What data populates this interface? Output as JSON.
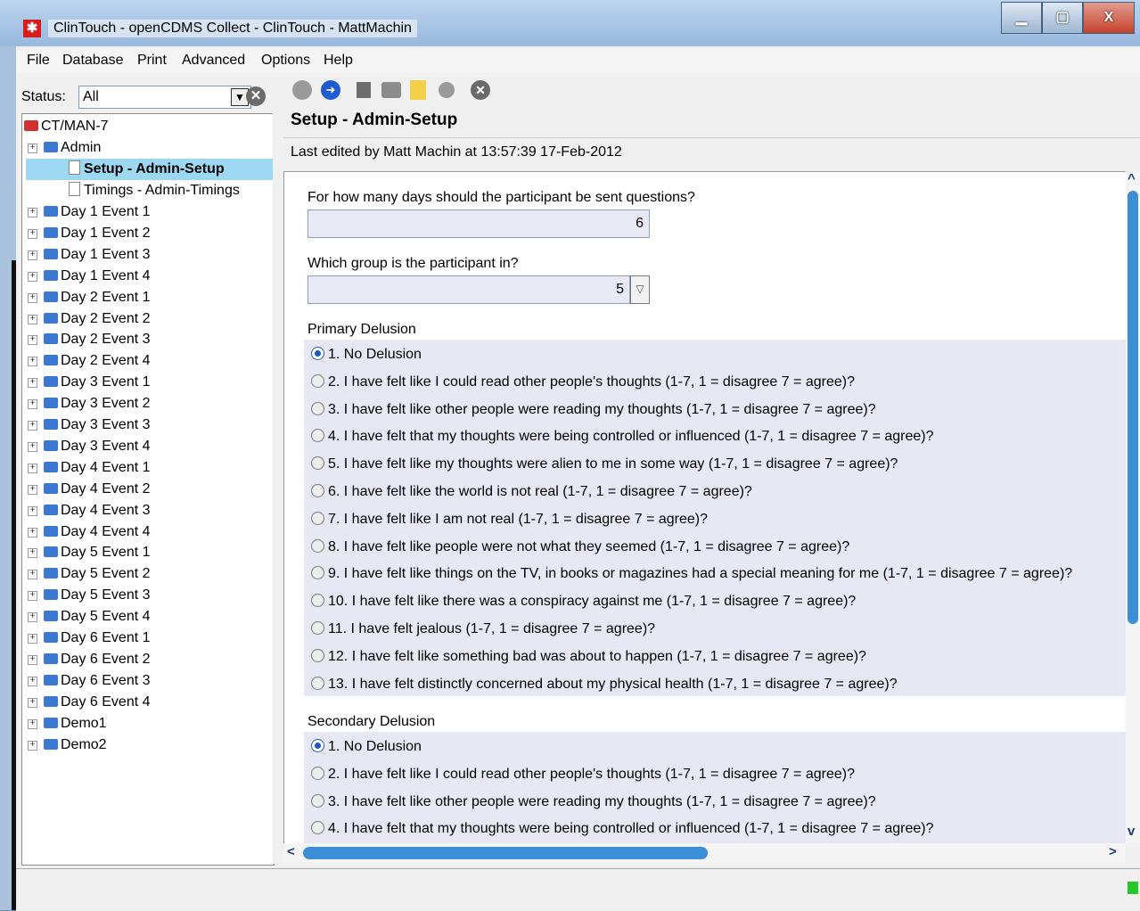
{
  "window": {
    "title": "ClinTouch - openCDMS Collect - ClinTouch - MattMachin",
    "minimize": "▁",
    "maximize": "▢",
    "close": "X"
  },
  "menu": [
    "File",
    "Database",
    "Print",
    "Advanced",
    "Options",
    "Help"
  ],
  "status": {
    "label": "Status:",
    "value": "All"
  },
  "tree": {
    "root": "CT/MAN-7",
    "admin": "Admin",
    "selected": "Setup - Admin-Setup",
    "timings": "Timings - Admin-Timings",
    "events": [
      "Day 1 Event 1",
      "Day 1 Event 2",
      "Day 1 Event 3",
      "Day 1 Event 4",
      "Day 2 Event 1",
      "Day 2 Event 2",
      "Day 2 Event 3",
      "Day 2 Event 4",
      "Day 3 Event 1",
      "Day 3 Event 2",
      "Day 3 Event 3",
      "Day 3 Event 4",
      "Day 4 Event 1",
      "Day 4 Event 2",
      "Day 4 Event 3",
      "Day 4 Event 4",
      "Day 5 Event 1",
      "Day 5 Event 2",
      "Day 5 Event 3",
      "Day 5 Event 4",
      "Day 6 Event 1",
      "Day 6 Event 2",
      "Day 6 Event 3",
      "Day 6 Event 4",
      "Demo1",
      "Demo2"
    ]
  },
  "form": {
    "title": "Setup - Admin-Setup",
    "last_edited": "Last edited by Matt Machin at 13:57:39 17-Feb-2012",
    "q1": {
      "label": "For how many days should the participant be sent questions?",
      "value": "6"
    },
    "q2": {
      "label": "Which group is the participant in?",
      "value": "5"
    },
    "primary": {
      "label": "Primary Delusion",
      "selected_index": 0,
      "options": [
        "1. No Delusion",
        "2. I have felt like I could read other people's thoughts (1-7, 1 = disagree 7 = agree)?",
        "3. I have felt like other people were reading my thoughts (1-7, 1 = disagree 7 = agree)?",
        "4. I have felt that my thoughts were being controlled or influenced (1-7, 1 = disagree 7 = agree)?",
        "5. I have felt like my thoughts were alien to me in some way (1-7, 1 = disagree 7 = agree)?",
        "6. I have felt like the world is not real (1-7, 1 = disagree 7 = agree)?",
        "7. I have felt like I am not real (1-7, 1 = disagree 7 = agree)?",
        "8. I have felt like people were not what they seemed (1-7, 1 = disagree 7 = agree)?",
        "9. I have felt like things on the TV, in books or magazines had a special meaning for me (1-7, 1 = disagree 7 = agree)?",
        "10. I have felt like there was a conspiracy against me (1-7, 1 = disagree 7 = agree)?",
        "11. I have felt jealous (1-7, 1 = disagree 7 = agree)?",
        "12. I have felt like something bad was about to happen (1-7, 1 = disagree 7 = agree)?",
        "13. I have felt distinctly concerned about my physical health (1-7, 1 = disagree 7 = agree)?"
      ]
    },
    "secondary": {
      "label": "Secondary Delusion",
      "selected_index": 0,
      "options": [
        "1. No Delusion",
        "2. I have felt like I could read other people's thoughts (1-7, 1 = disagree 7 = agree)?",
        "3. I have felt like other people were reading my thoughts (1-7, 1 = disagree 7 = agree)?",
        "4. I have felt that my thoughts were being controlled or influenced (1-7, 1 = disagree 7 = agree)?"
      ]
    }
  },
  "colors": {
    "accent": "#3c8fd6",
    "selection": "#9dd8f2",
    "band": "#e8e8f5"
  }
}
